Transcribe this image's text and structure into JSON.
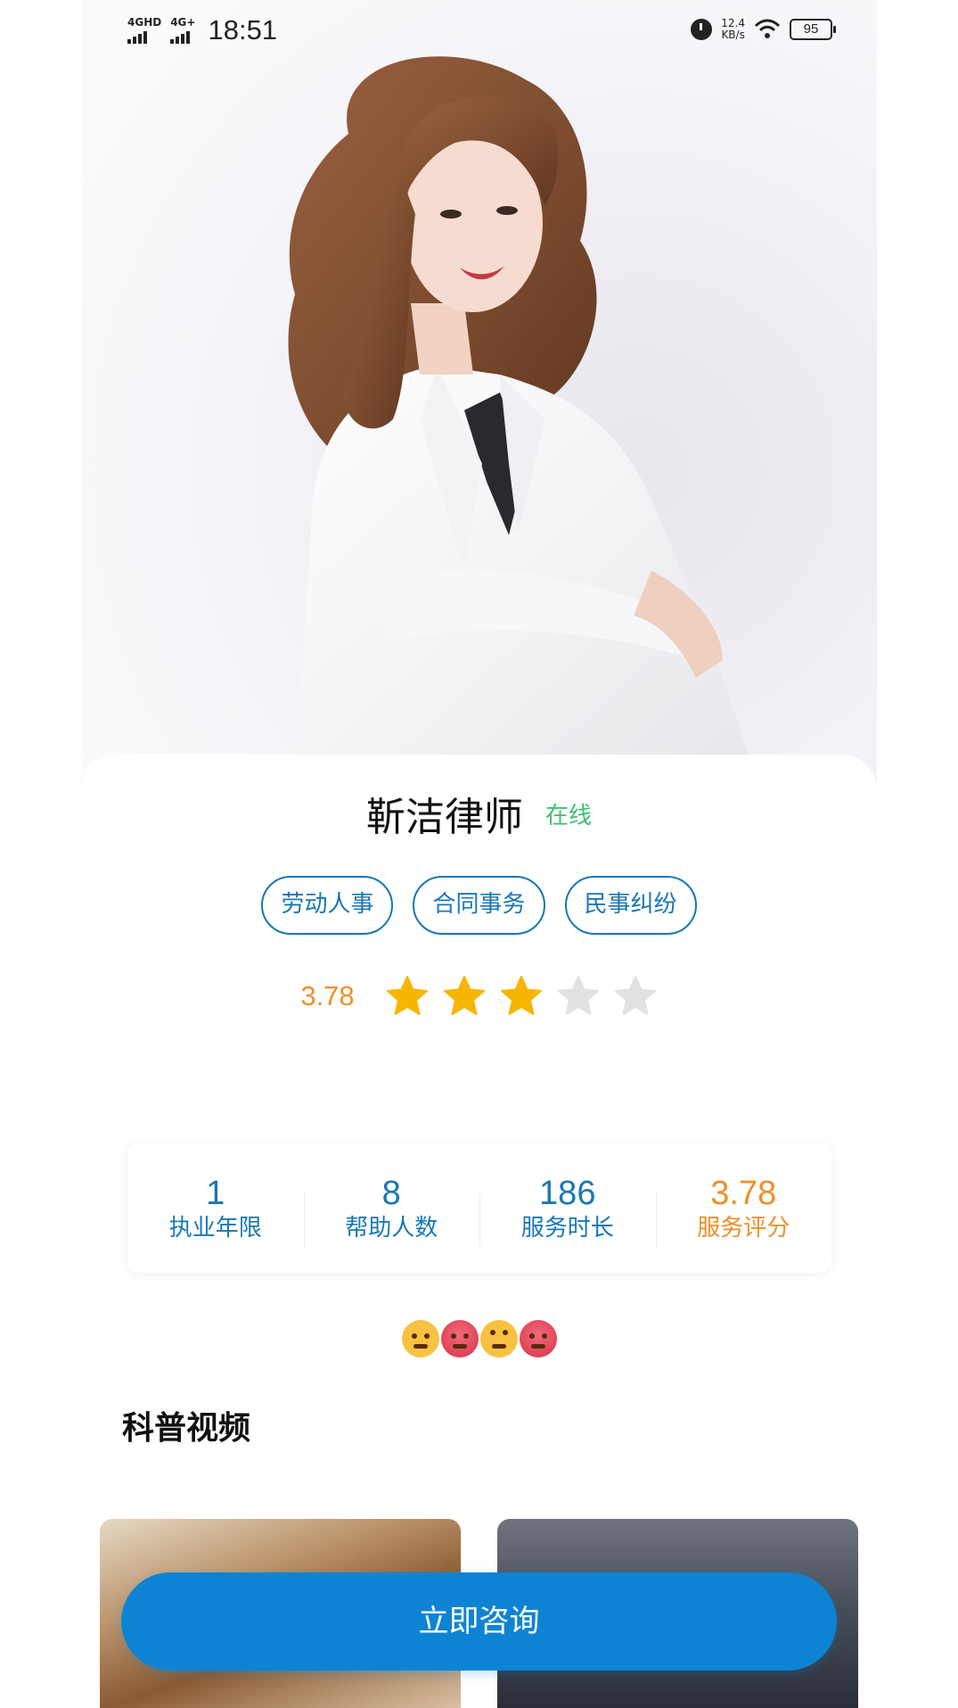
{
  "status_bar": {
    "network_1": "4GHD",
    "network_2": "4G+",
    "time": "18:51",
    "speed_value": "12.4",
    "speed_unit": "KB/s",
    "battery": "95",
    "icons": [
      "alarm-icon",
      "wifi-icon",
      "battery-icon"
    ]
  },
  "hero": {
    "photo": "lawyer-portrait-photo"
  },
  "profile": {
    "name": "靳洁律师",
    "status": "在线",
    "status_color": "#3cc16d",
    "tags": [
      "劳动人事",
      "合同事务",
      "民事纠纷"
    ],
    "rating_text": "3.78",
    "rating_value": 3.78,
    "stars_filled": 3,
    "stars_total": 5
  },
  "stats": [
    {
      "value": "1",
      "label": "执业年限"
    },
    {
      "value": "8",
      "label": "帮助人数"
    },
    {
      "value": "186",
      "label": "服务时长"
    },
    {
      "value": "3.78",
      "label": "服务评分"
    }
  ],
  "emojis": [
    "hugging-face-emoji",
    "angry-face-emoji",
    "eye-roll-emoji",
    "angry-face-emoji"
  ],
  "videos_section": {
    "title": "科普视频",
    "videos": [
      "video-thumbnail-camels",
      "video-thumbnail-city"
    ]
  },
  "cta": {
    "label": "立即咨询"
  },
  "colors": {
    "accent_blue": "#1977b4",
    "cta_blue": "#0d84d3",
    "rating_orange": "#ee8f2b",
    "star_gold": "#f7b500",
    "star_gray": "#e2e2e2"
  }
}
